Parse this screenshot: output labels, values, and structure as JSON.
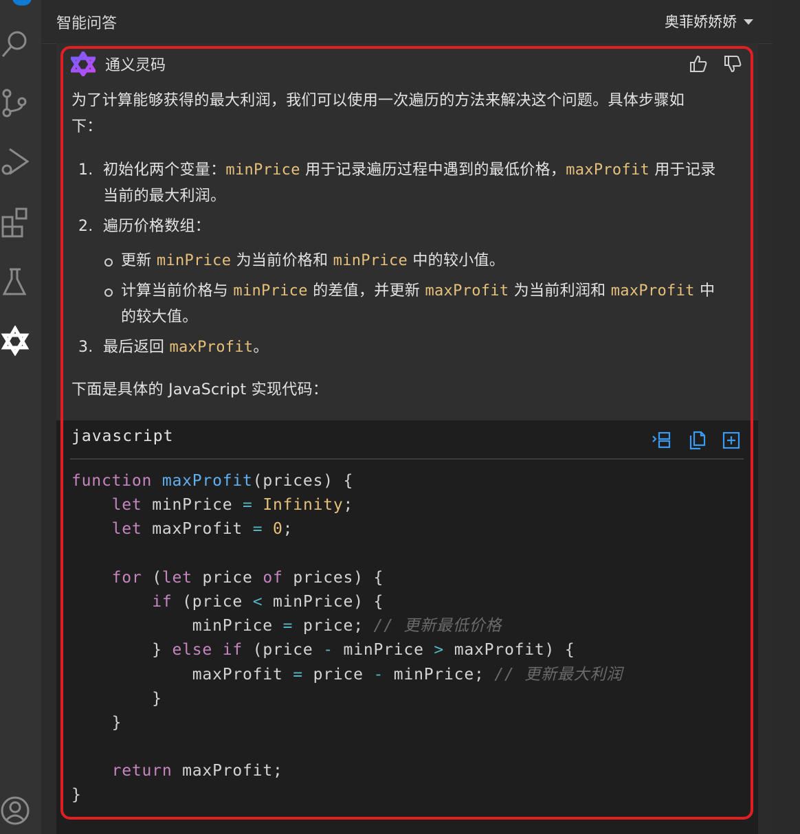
{
  "panel": {
    "title": "智能问答",
    "user": "奥菲娇娇娇"
  },
  "assistant": {
    "name": "通义灵码"
  },
  "message": {
    "intro": "为了计算能够获得的最大利润，我们可以使用一次遍历的方法来解决这个问题。具体步骤如",
    "intro_cont": "下：",
    "steps": [
      {
        "num": "1.",
        "p1": "初始化两个变量：",
        "c1": "minPrice",
        "p2": " 用于记录遍历过程中遇到的最低价格，",
        "c2": "maxProfit",
        "p3": " 用于记录",
        "cont": "当前的最大利润。"
      },
      {
        "num": "2.",
        "text": "遍历价格数组："
      },
      {
        "num": "3.",
        "p1": "最后返回 ",
        "c1": "maxProfit",
        "p2": "。"
      }
    ],
    "substeps": [
      {
        "p1": "更新 ",
        "c1": "minPrice",
        "p2": " 为当前价格和 ",
        "c2": "minPrice",
        "p3": " 中的较小值。"
      },
      {
        "p1": "计算当前价格与 ",
        "c1": "minPrice",
        "p2": " 的差值，并更新 ",
        "c2": "maxProfit",
        "p3": " 为当前利润和 ",
        "c3": "maxProfit",
        "p4": " 中",
        "cont": "的较大值。"
      }
    ],
    "outro": "下面是具体的 JavaScript 实现代码："
  },
  "code": {
    "language": "javascript",
    "tokens": {
      "function": "function",
      "let": "let",
      "for": "for",
      "of": "of",
      "if": "if",
      "else": "else",
      "return": "return",
      "maxProfit": "maxProfit",
      "minPrice": "minPrice",
      "prices": "prices",
      "price": "price",
      "Infinity": "Infinity",
      "zero": "0",
      "assign": "=",
      "lt": "<",
      "gt": ">",
      "minus": "-",
      "comment1": "// 更新最低价格",
      "comment2": "// 更新最大利润"
    }
  },
  "colors": {
    "highlight": "#e02020",
    "accent": "#3a9cf5",
    "inline_code": "#e6c07b",
    "keyword": "#c586c0",
    "function": "#61afef"
  }
}
